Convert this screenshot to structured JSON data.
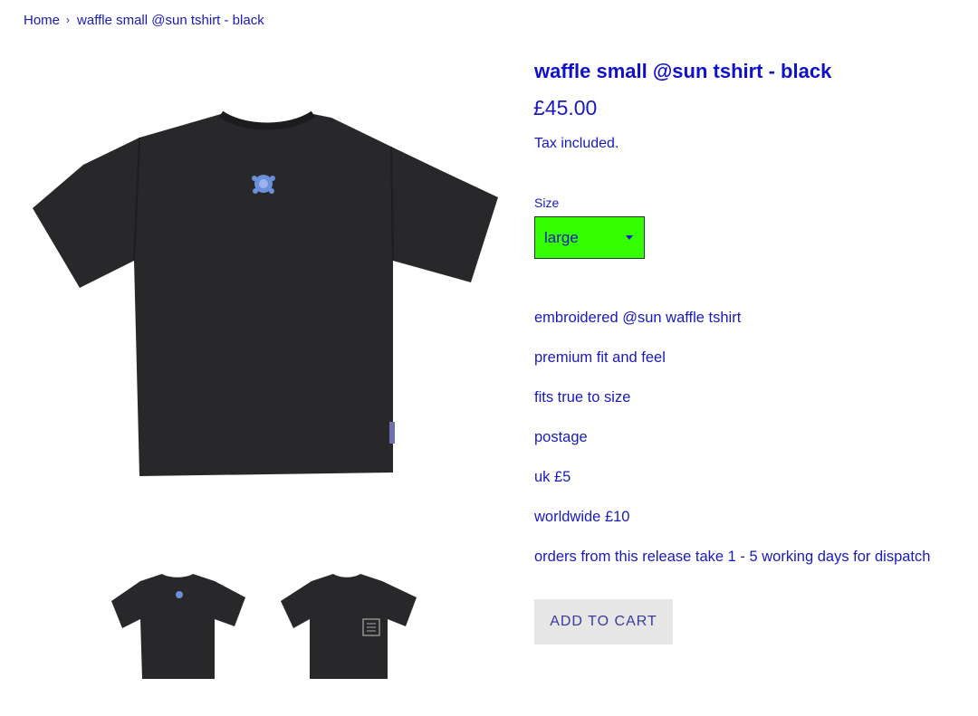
{
  "breadcrumb": {
    "home": "Home",
    "current": "waffle small @sun tshirt - black"
  },
  "product": {
    "title": "waffle small @sun tshirt - black",
    "price": "£45.00",
    "tax_note": "Tax included.",
    "size_label": "Size",
    "size_selected": "large",
    "description": [
      "embroidered @sun waffle tshirt",
      "premium fit and feel",
      "fits true to size",
      "postage",
      "uk £5",
      "worldwide £10",
      "orders from this release take 1 - 5 working days for dispatch"
    ],
    "add_to_cart_label": "ADD TO CART"
  },
  "colors": {
    "link": "#1a1ab8",
    "select_bg": "#33ff00",
    "button_bg": "#e6e6e6",
    "shirt": "#28272a"
  },
  "icons": {
    "breadcrumb_separator": "chevron-right-icon",
    "select_caret": "caret-down-icon"
  }
}
